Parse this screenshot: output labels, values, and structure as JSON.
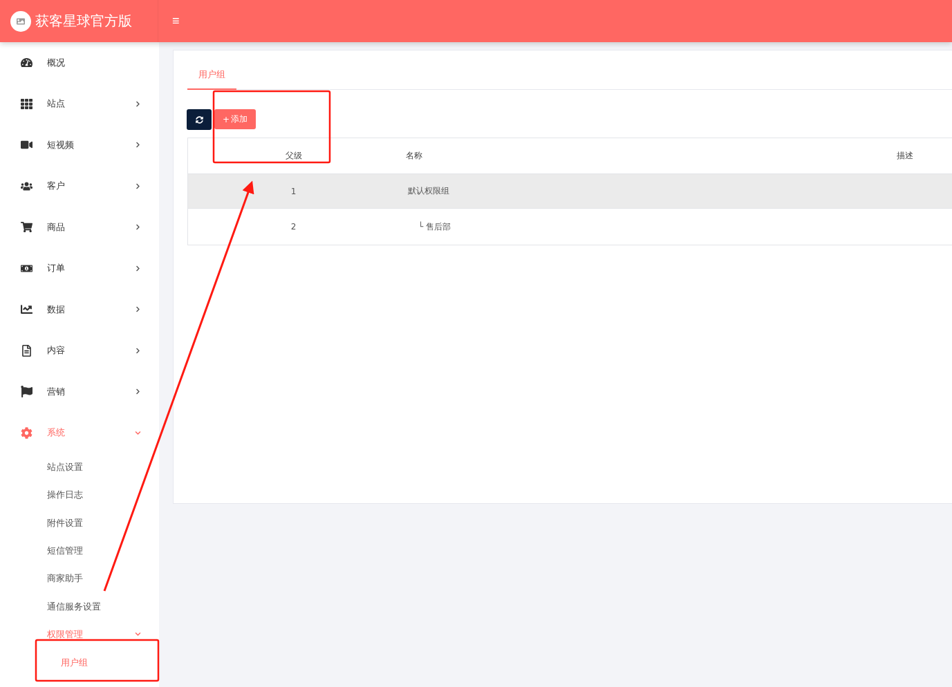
{
  "header": {
    "brand": "获客星球官方版",
    "menu_glyph": "≡"
  },
  "sidebar": {
    "items": [
      {
        "label": "概况",
        "kind": "link"
      },
      {
        "label": "站点",
        "kind": "menu",
        "expanded": false
      },
      {
        "label": "短视频",
        "kind": "menu",
        "expanded": false
      },
      {
        "label": "客户",
        "kind": "menu",
        "expanded": false
      },
      {
        "label": "商品",
        "kind": "menu",
        "expanded": false
      },
      {
        "label": "订单",
        "kind": "menu",
        "expanded": false
      },
      {
        "label": "数据",
        "kind": "menu",
        "expanded": false
      },
      {
        "label": "内容",
        "kind": "menu",
        "expanded": false
      },
      {
        "label": "营销",
        "kind": "menu",
        "expanded": false
      },
      {
        "label": "系统",
        "kind": "menu",
        "expanded": true,
        "children": [
          {
            "label": "站点设置",
            "kind": "link"
          },
          {
            "label": "操作日志",
            "kind": "link"
          },
          {
            "label": "附件设置",
            "kind": "link"
          },
          {
            "label": "短信管理",
            "kind": "link"
          },
          {
            "label": "商家助手",
            "kind": "link"
          },
          {
            "label": "通信服务设置",
            "kind": "link"
          },
          {
            "label": "权限管理",
            "kind": "menu",
            "expanded": true,
            "children": [
              {
                "label": "用户组",
                "selected": true
              }
            ]
          }
        ]
      }
    ]
  },
  "tabs": [
    {
      "label": "用户组",
      "selected": true
    }
  ],
  "toolbar": {
    "add_label": "添加",
    "add_glyph": "+"
  },
  "table": {
    "columns": [
      "父级",
      "名称",
      "描述"
    ],
    "rows": [
      {
        "parent": "1",
        "name": "默认权限组",
        "highlighted": true
      },
      {
        "parent": "2",
        "name": "└ 售后部",
        "highlighted": false
      }
    ]
  }
}
